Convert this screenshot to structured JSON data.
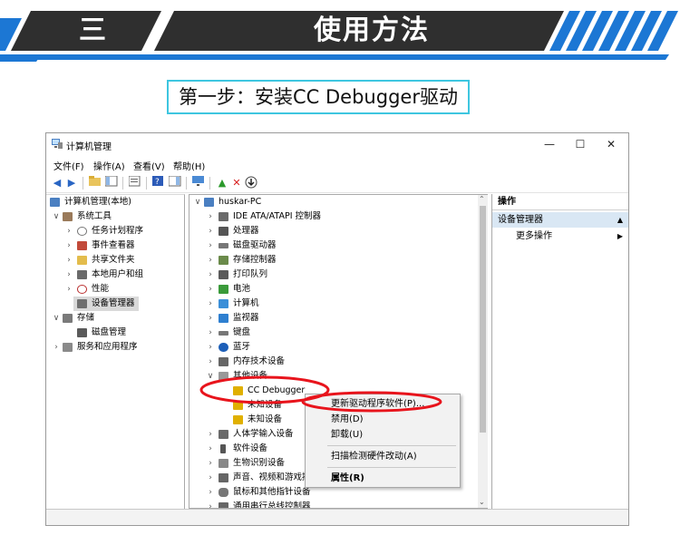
{
  "banner": {
    "number": "三",
    "title": "使用方法"
  },
  "step_caption": "第一步：安装CC Debugger驱动",
  "window": {
    "title": "计算机管理",
    "controls": [
      "—",
      "☐",
      "✕"
    ],
    "menu": [
      "文件(F)",
      "操作(A)",
      "查看(V)",
      "帮助(H)"
    ]
  },
  "left_tree": [
    {
      "label": "计算机管理(本地)"
    },
    {
      "label": "系统工具"
    },
    {
      "label": "任务计划程序"
    },
    {
      "label": "事件查看器"
    },
    {
      "label": "共享文件夹"
    },
    {
      "label": "本地用户和组"
    },
    {
      "label": "性能"
    },
    {
      "label": "设备管理器"
    },
    {
      "label": "存储"
    },
    {
      "label": "磁盘管理"
    },
    {
      "label": "服务和应用程序"
    }
  ],
  "device_tree": [
    {
      "label": "huskar-PC"
    },
    {
      "label": "IDE ATA/ATAPI 控制器"
    },
    {
      "label": "处理器"
    },
    {
      "label": "磁盘驱动器"
    },
    {
      "label": "存储控制器"
    },
    {
      "label": "打印队列"
    },
    {
      "label": "电池"
    },
    {
      "label": "计算机"
    },
    {
      "label": "监视器"
    },
    {
      "label": "键盘"
    },
    {
      "label": "蓝牙"
    },
    {
      "label": "内存技术设备"
    },
    {
      "label": "其他设备"
    },
    {
      "label": "CC Debugger"
    },
    {
      "label": "未知设备"
    },
    {
      "label": "未知设备"
    },
    {
      "label": "人体学输入设备"
    },
    {
      "label": "软件设备"
    },
    {
      "label": "生物识别设备"
    },
    {
      "label": "声音、视频和游戏控制器"
    },
    {
      "label": "鼠标和其他指针设备"
    },
    {
      "label": "通用串行总线控制器"
    }
  ],
  "actions": {
    "header": "操作",
    "section": "设备管理器",
    "more": "更多操作"
  },
  "context_menu": [
    {
      "label": "更新驱动程序软件(P)..."
    },
    {
      "label": "禁用(D)"
    },
    {
      "label": "卸载(U)"
    },
    {
      "label": "扫描检测硬件改动(A)"
    },
    {
      "label": "属性(R)"
    }
  ],
  "colors": {
    "banner_dark": "#3a3a3a",
    "banner_blue": "#1c77d4",
    "caption_border": "#3ec6e0",
    "highlight_red": "#e8141c"
  }
}
